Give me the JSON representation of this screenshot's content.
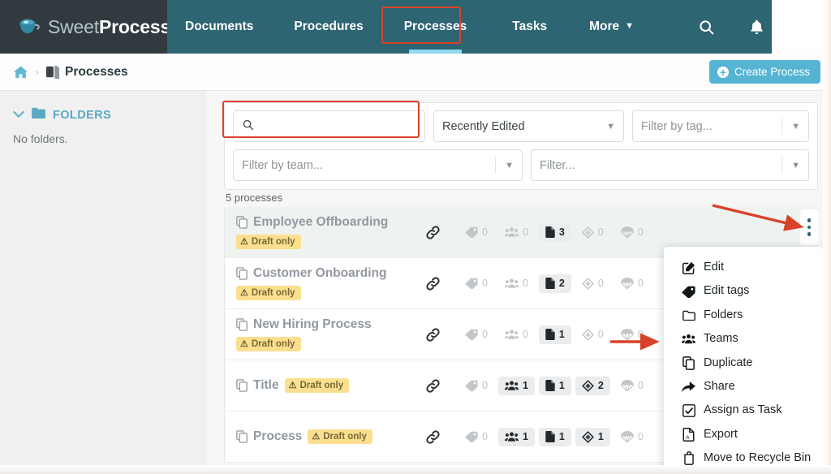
{
  "brand": {
    "name_thin": "Sweet",
    "name_bold": "Process",
    "logo_icon": "coffee-cup-icon"
  },
  "topnav": {
    "items": [
      {
        "label": "Documents",
        "active": false
      },
      {
        "label": "Procedures",
        "active": false
      },
      {
        "label": "Processes",
        "active": true
      },
      {
        "label": "Tasks",
        "active": false
      },
      {
        "label": "More",
        "active": false,
        "has_caret": true
      }
    ],
    "search_icon": "search-icon",
    "bell_icon": "bell-icon"
  },
  "breadcrumb": {
    "home_icon": "home-icon",
    "separator": "›",
    "doc_icon": "documents-icon",
    "current": "Processes"
  },
  "create_button": {
    "label": "Create Process",
    "icon": "plus-circle-icon"
  },
  "sidebar": {
    "folders_header": "FOLDERS",
    "folder_icon": "folder-icon",
    "chevron_icon": "chevron-down-icon",
    "empty_text": "No folders."
  },
  "filters": {
    "search": {
      "placeholder": "",
      "value": "",
      "icon": "search-icon"
    },
    "sort": {
      "value": "Recently Edited"
    },
    "tag": {
      "value": "Filter by tag..."
    },
    "team": {
      "value": "Filter by team..."
    },
    "generic": {
      "value": "Filter..."
    }
  },
  "list": {
    "count_label": "5 processes",
    "columns": [
      "tags",
      "teams",
      "documents",
      "flows",
      "published"
    ],
    "rows": [
      {
        "title": "Employee Offboarding",
        "badge": "Draft only",
        "highlight": true,
        "inline_badge": false,
        "stats": [
          {
            "icon": "tag-icon",
            "value": "0",
            "active": false
          },
          {
            "icon": "teams-icon",
            "value": "0",
            "active": false
          },
          {
            "icon": "document-icon",
            "value": "3",
            "active": true
          },
          {
            "icon": "diamond-icon",
            "value": "0",
            "active": false
          },
          {
            "icon": "parachute-icon",
            "value": "0",
            "active": false
          }
        ]
      },
      {
        "title": "Customer Onboarding",
        "badge": "Draft only",
        "highlight": false,
        "inline_badge": false,
        "stats": [
          {
            "icon": "tag-icon",
            "value": "0",
            "active": false
          },
          {
            "icon": "teams-icon",
            "value": "0",
            "active": false
          },
          {
            "icon": "document-icon",
            "value": "2",
            "active": true
          },
          {
            "icon": "diamond-icon",
            "value": "0",
            "active": false
          },
          {
            "icon": "parachute-icon",
            "value": "0",
            "active": false
          }
        ]
      },
      {
        "title": "New Hiring Process",
        "badge": "Draft only",
        "highlight": false,
        "inline_badge": false,
        "stats": [
          {
            "icon": "tag-icon",
            "value": "0",
            "active": false
          },
          {
            "icon": "teams-icon",
            "value": "0",
            "active": false
          },
          {
            "icon": "document-icon",
            "value": "1",
            "active": true
          },
          {
            "icon": "diamond-icon",
            "value": "0",
            "active": false
          },
          {
            "icon": "parachute-icon",
            "value": "0",
            "active": false
          }
        ]
      },
      {
        "title": "Title",
        "badge": "Draft only",
        "highlight": false,
        "inline_badge": true,
        "stats": [
          {
            "icon": "tag-icon",
            "value": "0",
            "active": false
          },
          {
            "icon": "teams-icon",
            "value": "1",
            "active": true
          },
          {
            "icon": "document-icon",
            "value": "1",
            "active": true
          },
          {
            "icon": "diamond-icon",
            "value": "2",
            "active": true
          },
          {
            "icon": "parachute-icon",
            "value": "0",
            "active": false
          }
        ]
      },
      {
        "title": "Process",
        "badge": "Draft only",
        "highlight": false,
        "inline_badge": true,
        "stats": [
          {
            "icon": "tag-icon",
            "value": "0",
            "active": false
          },
          {
            "icon": "teams-icon",
            "value": "1",
            "active": true
          },
          {
            "icon": "document-icon",
            "value": "1",
            "active": true
          },
          {
            "icon": "diamond-icon",
            "value": "1",
            "active": true
          },
          {
            "icon": "parachute-icon",
            "value": "0",
            "active": false
          }
        ]
      }
    ]
  },
  "context_menu": {
    "items": [
      {
        "label": "Edit",
        "icon": "pencil-square-icon"
      },
      {
        "label": "Edit tags",
        "icon": "tag-icon"
      },
      {
        "label": "Folders",
        "icon": "folder-icon"
      },
      {
        "label": "Teams",
        "icon": "teams-icon"
      },
      {
        "label": "Duplicate",
        "icon": "copy-icon"
      },
      {
        "label": "Share",
        "icon": "share-arrow-icon"
      },
      {
        "label": "Assign as Task",
        "icon": "checkbox-icon"
      },
      {
        "label": "Export",
        "icon": "export-file-icon"
      },
      {
        "label": "Move to Recycle Bin",
        "icon": "trash-icon"
      }
    ]
  },
  "kebab": {
    "icon": "kebab-menu-icon"
  },
  "annotations": {
    "accent_color": "#d9422a",
    "highlight_boxes": [
      "processes-tab",
      "search-input"
    ],
    "arrows": [
      "arrow-to-kebab",
      "arrow-to-teams"
    ]
  },
  "colors": {
    "logo_bg": "#313a3e",
    "nav_bg": "#2d6573",
    "active_underline": "#8fd8ee",
    "primary_button": "#56b4d3",
    "draft_badge": "#fbdf8f",
    "annotation": "#d9422a"
  }
}
